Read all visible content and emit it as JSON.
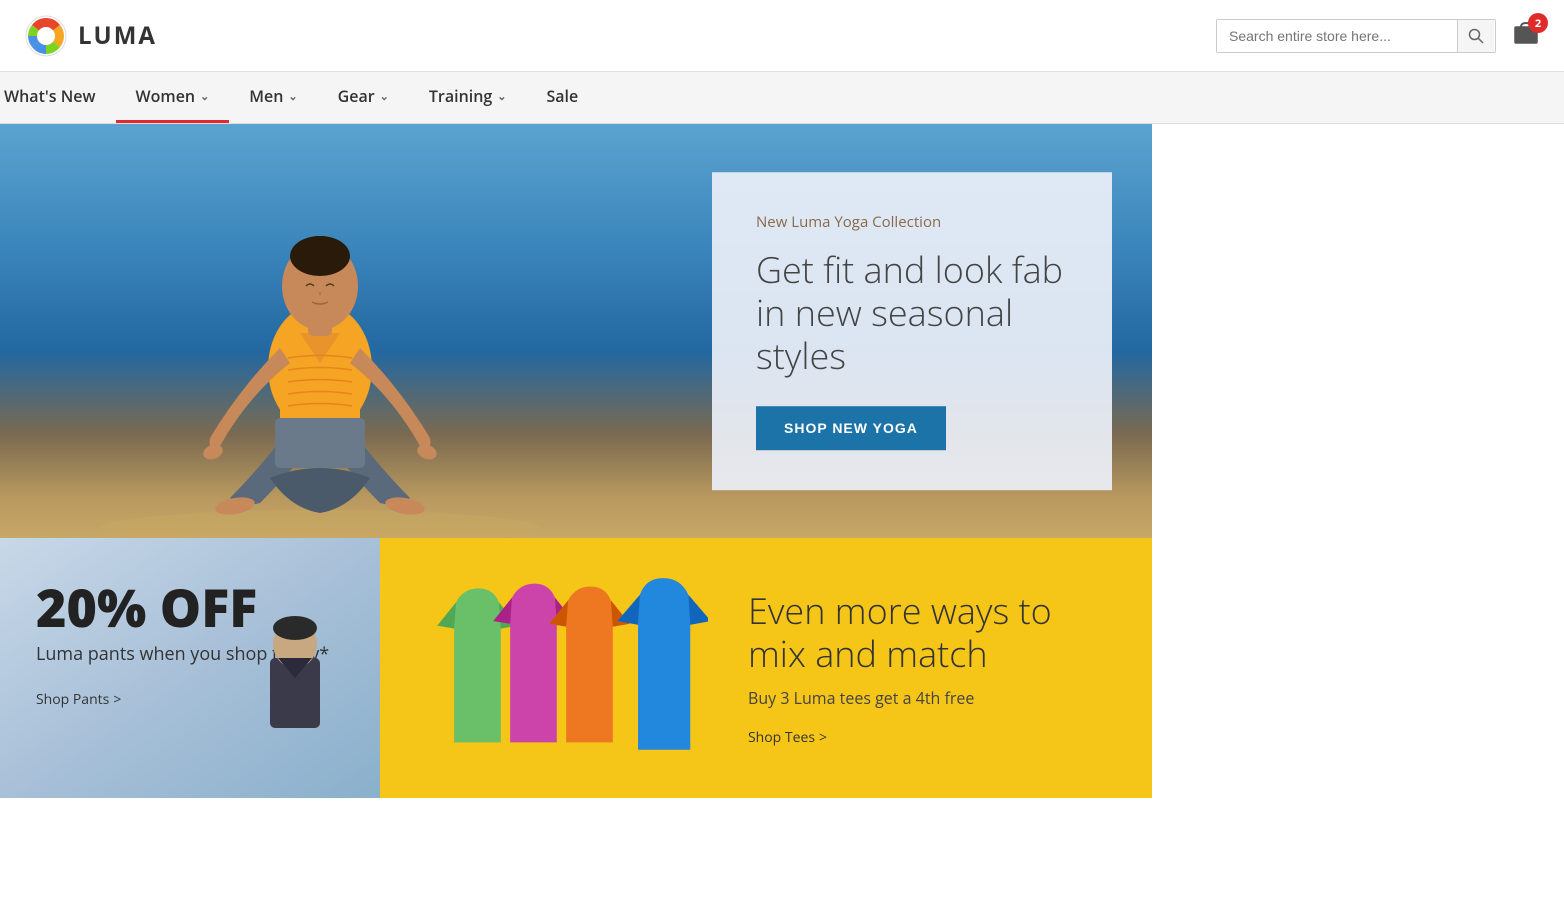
{
  "header": {
    "logo_text": "LUMA",
    "search_placeholder": "Search entire store here...",
    "cart_count": "2"
  },
  "nav": {
    "items": [
      {
        "label": "What's New",
        "active": false,
        "has_dropdown": false
      },
      {
        "label": "Women",
        "active": true,
        "has_dropdown": true
      },
      {
        "label": "Men",
        "active": false,
        "has_dropdown": true
      },
      {
        "label": "Gear",
        "active": false,
        "has_dropdown": true
      },
      {
        "label": "Training",
        "active": false,
        "has_dropdown": true
      },
      {
        "label": "Sale",
        "active": false,
        "has_dropdown": false
      }
    ]
  },
  "hero": {
    "subtitle": "New Luma Yoga Collection",
    "title": "Get fit and look fab in new seasonal styles",
    "cta_label": "Shop New Yoga"
  },
  "promo_left": {
    "discount": "20% OFF",
    "description": "Luma pants when you shop today*",
    "link_label": "Shop Pants",
    "link_arrow": ">"
  },
  "promo_right": {
    "title": "Even more ways to mix and match",
    "subtitle": "Buy 3 Luma tees get a 4th free",
    "link_label": "Shop Tees",
    "link_arrow": ">",
    "tee_colors": [
      "#6abf69",
      "#cc44aa",
      "#ee7722",
      "#2288dd"
    ]
  }
}
